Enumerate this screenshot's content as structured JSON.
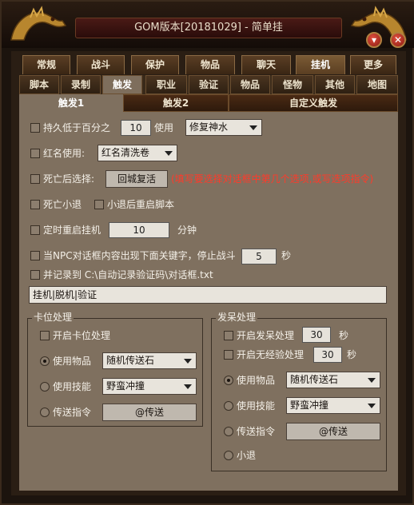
{
  "window": {
    "title": "GOM版本[20181029] - 简单挂",
    "minimize_symbol": "▾",
    "close_symbol": "✕"
  },
  "top_tabs": [
    "常规",
    "战斗",
    "保护",
    "物品",
    "聊天",
    "挂机",
    "更多"
  ],
  "top_tabs_active": "挂机",
  "sub_tabs": [
    "脚本",
    "录制",
    "触发",
    "职业",
    "验证",
    "物品",
    "怪物",
    "其他",
    "地图"
  ],
  "sub_tabs_active": "触发",
  "content_tabs": [
    "触发1",
    "触发2",
    "自定义触发"
  ],
  "content_tabs_active": "触发1",
  "rows": {
    "hold_below": {
      "label": "持久低于百分之",
      "value": "10",
      "use_label": "使用",
      "item": "修复神水",
      "checked": false
    },
    "red_name": {
      "label": "红名使用:",
      "item": "红名清洗卷",
      "checked": false
    },
    "after_death": {
      "label": "死亡后选择:",
      "button": "回城复活",
      "hint": "(填写要选择对话框中第几个选项,或写选项指令)",
      "checked": false
    },
    "death_logout": {
      "label": "死亡小退",
      "checked": false
    },
    "restart_script": {
      "label": "小退后重启脚本",
      "checked": false
    },
    "timed_restart": {
      "label": "定时重启挂机",
      "value": "10",
      "unit": "分钟",
      "checked": false
    },
    "npc_keyword": {
      "label": "当NPC对话框内容出现下面关键字，停止战斗",
      "value": "5",
      "unit": "秒",
      "checked": false
    },
    "record_to": {
      "label": "并记录到 C:\\自动记录验证码\\对话框.txt",
      "checked": false
    },
    "keyword_text": "挂机|脱机|验证"
  },
  "stuck_group": {
    "title": "卡位处理",
    "enable": {
      "label": "开启卡位处理",
      "checked": false
    },
    "use_item": {
      "label": "使用物品",
      "value": "随机传送石",
      "selected": true
    },
    "use_skill": {
      "label": "使用技能",
      "value": "野蛮冲撞",
      "selected": false
    },
    "teleport_cmd": {
      "label": "传送指令",
      "value": "@传送",
      "selected": false
    }
  },
  "idle_group": {
    "title": "发呆处理",
    "enable": {
      "label": "开启发呆处理",
      "value": "30",
      "unit": "秒",
      "checked": false
    },
    "no_exp": {
      "label": "开启无经验处理",
      "value": "30",
      "unit": "秒",
      "checked": false
    },
    "use_item": {
      "label": "使用物品",
      "value": "随机传送石",
      "selected": true
    },
    "use_skill": {
      "label": "使用技能",
      "value": "野蛮冲撞",
      "selected": false
    },
    "teleport_cmd": {
      "label": "传送指令",
      "value": "@传送",
      "selected": false
    },
    "logout": {
      "label": "小退",
      "selected": false
    }
  }
}
